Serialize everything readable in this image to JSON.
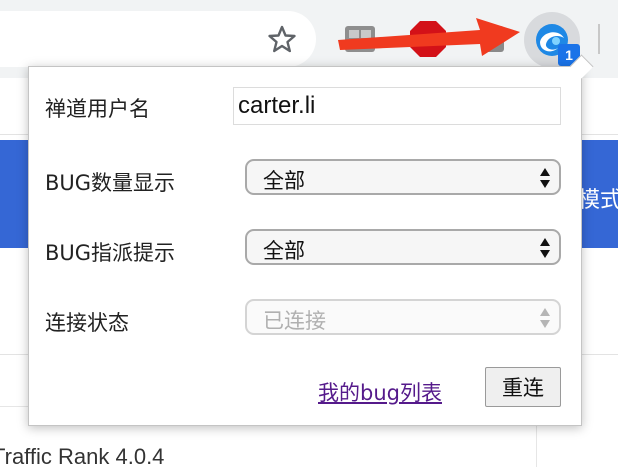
{
  "form": {
    "username_label": "禅道用户名",
    "username_value": "carter.li",
    "bug_count_label": "BUG数量显示",
    "bug_count_value": "全部",
    "bug_assign_label": "BUG指派提示",
    "bug_assign_value": "全部",
    "connection_label": "连接状态",
    "connection_value": "已连接",
    "my_bugs_link": "我的bug列表",
    "reconnect_button": "重连"
  },
  "extension": {
    "badge_count": "1"
  },
  "page": {
    "blue_bar_text": "模式",
    "bottom_text": "Traffic Rank   4.0.4"
  },
  "colors": {
    "page_blue": "#3567d5",
    "badge_blue": "#1a73e8",
    "arrow_red": "#f03a1f",
    "link_purple": "#551a8b"
  },
  "icons": [
    "star-icon",
    "extension-icon",
    "chevron-updown-icon",
    "red-arrow-annotation"
  ]
}
